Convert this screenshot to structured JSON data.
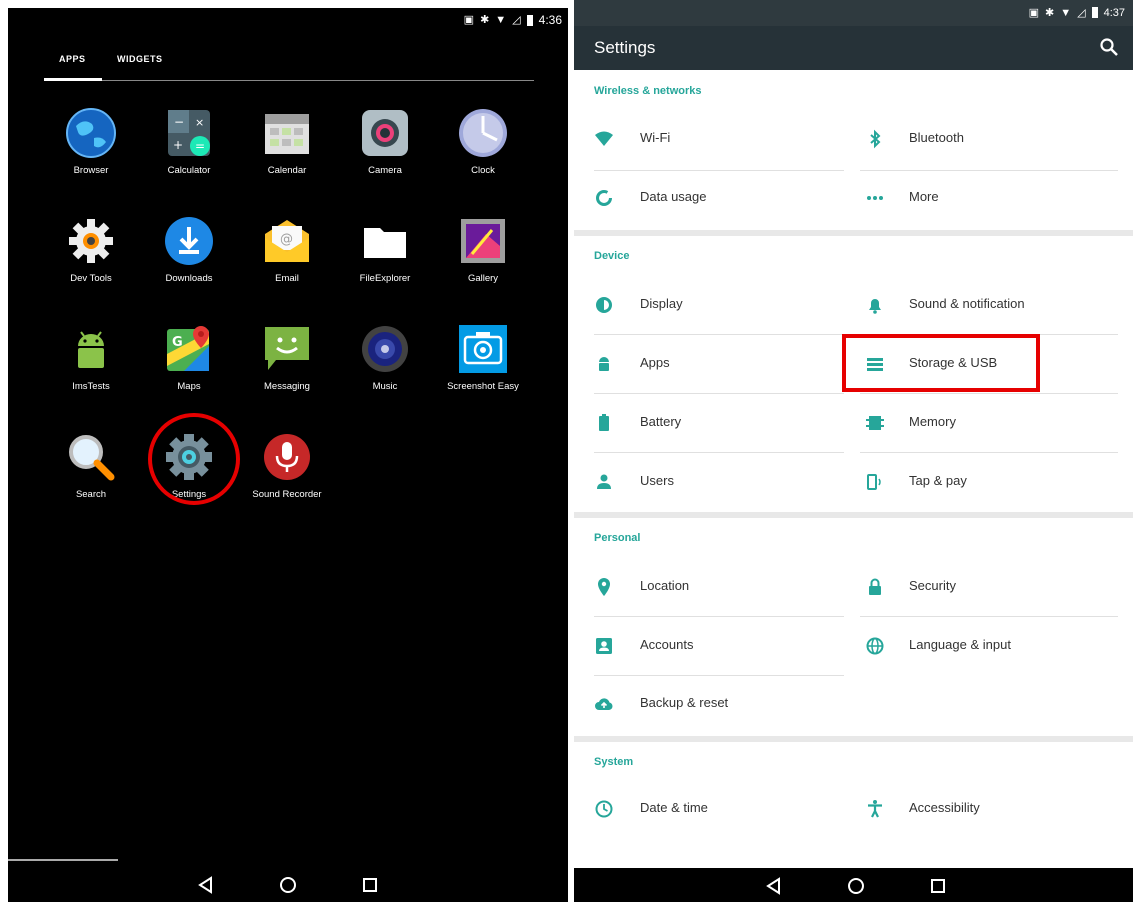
{
  "left": {
    "status": {
      "time": "4:36"
    },
    "tabs": {
      "apps": "APPS",
      "widgets": "WIDGETS"
    },
    "apps": [
      {
        "label": "Browser",
        "icon": "globe-icon"
      },
      {
        "label": "Calculator",
        "icon": "calculator-icon"
      },
      {
        "label": "Calendar",
        "icon": "calendar-icon"
      },
      {
        "label": "Camera",
        "icon": "camera-icon"
      },
      {
        "label": "Clock",
        "icon": "clock-icon"
      },
      {
        "label": "Dev Tools",
        "icon": "gear-icon"
      },
      {
        "label": "Downloads",
        "icon": "download-icon"
      },
      {
        "label": "Email",
        "icon": "envelope-icon"
      },
      {
        "label": "FileExplorer",
        "icon": "folder-icon"
      },
      {
        "label": "Gallery",
        "icon": "picture-icon"
      },
      {
        "label": "ImsTests",
        "icon": "android-icon"
      },
      {
        "label": "Maps",
        "icon": "map-icon"
      },
      {
        "label": "Messaging",
        "icon": "chat-icon"
      },
      {
        "label": "Music",
        "icon": "speaker-icon"
      },
      {
        "label": "Screenshot Easy",
        "icon": "camera-icon"
      },
      {
        "label": "Search",
        "icon": "magnifier-icon"
      },
      {
        "label": "Settings",
        "icon": "gear-icon"
      },
      {
        "label": "Sound Recorder",
        "icon": "microphone-icon"
      }
    ]
  },
  "right": {
    "status": {
      "time": "4:37"
    },
    "toolbar": {
      "title": "Settings"
    },
    "sections": {
      "wireless": {
        "title": "Wireless & networks",
        "items": [
          "Wi-Fi",
          "Bluetooth",
          "Data usage",
          "More"
        ]
      },
      "device": {
        "title": "Device",
        "items": [
          "Display",
          "Sound & notification",
          "Apps",
          "Storage & USB",
          "Battery",
          "Memory",
          "Users",
          "Tap & pay"
        ]
      },
      "personal": {
        "title": "Personal",
        "items": [
          "Location",
          "Security",
          "Accounts",
          "Language & input",
          "Backup & reset"
        ]
      },
      "system": {
        "title": "System",
        "items": [
          "Date & time",
          "Accessibility"
        ]
      }
    },
    "colors": {
      "accent": "#26a69a",
      "highlight": "#e60000",
      "toolbar": "#263238"
    }
  }
}
